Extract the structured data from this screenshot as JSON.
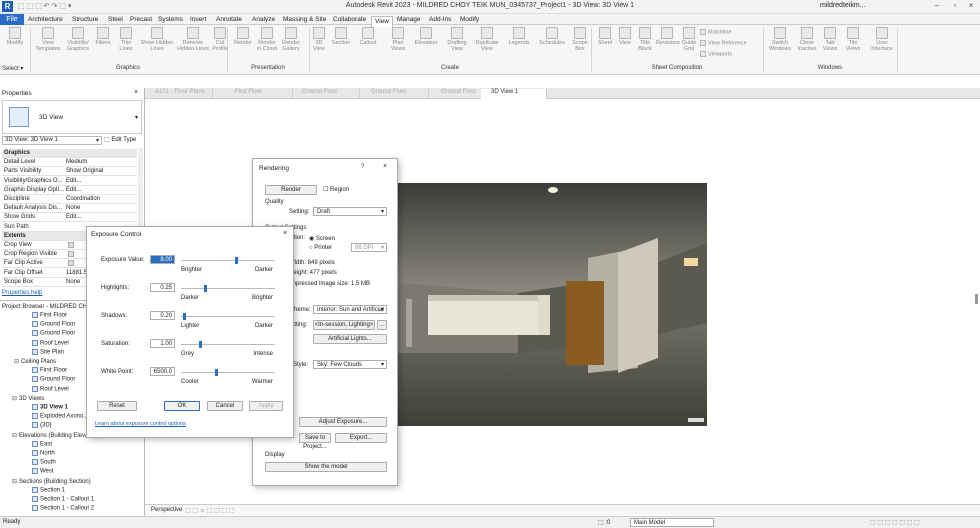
{
  "window": {
    "title": "Autodesk Revit 2023 - MILDRED CHOY TEIK MUN_0345737_Project1 - 3D View: 3D View 1",
    "user": "mildredteikm..."
  },
  "ribbon_tabs": [
    "Architecture",
    "Structure",
    "Steel",
    "Precast",
    "Systems",
    "Insert",
    "Annotate",
    "Analyze",
    "Massing & Site",
    "Collaborate",
    "View",
    "Manage",
    "Add-Ins",
    "Modify"
  ],
  "file_tab": "File",
  "ribbon": {
    "modify": "Modify",
    "select": "Select",
    "buttons": [
      "View Templates",
      "Visibility/ Graphics",
      "Filters",
      "Thin Lines",
      "Show Hidden Lines",
      "Remove Hidden Lines",
      "Cut Profile",
      "Render",
      "Render in Cloud",
      "Render Gallery",
      "3D View",
      "Section",
      "Callout",
      "Plan Views",
      "Elevation",
      "Drafting View",
      "Duplicate View",
      "Legends",
      "Schedules",
      "Scope Box",
      "Sheet",
      "View",
      "Title Block",
      "Revisions",
      "Guide Grid",
      "Matchline",
      "View Reference",
      "Viewports",
      "Switch Windows",
      "Close Inactive",
      "Tab Views",
      "Tile Views",
      "User Interface"
    ],
    "panels": [
      "Graphics",
      "Presentation",
      "Create",
      "Sheet Composition",
      "Windows"
    ]
  },
  "doc_tabs": [
    "A101 - Floor Plans",
    "First Floor",
    "Ground Floor",
    "Ground Floor",
    "Ground Floor",
    "3D View 1"
  ],
  "properties": {
    "header": "Properties",
    "type": "3D View",
    "selector": "3D View: 3D View 1",
    "edit_type": "Edit Type",
    "rows": [
      {
        "k": "Graphics",
        "v": "",
        "section": true
      },
      {
        "k": "Detail Level",
        "v": "Medium"
      },
      {
        "k": "Parts Visibility",
        "v": "Show Original"
      },
      {
        "k": "Visibility/Graphics O...",
        "v": "Edit..."
      },
      {
        "k": "Graphic Display Opti...",
        "v": "Edit..."
      },
      {
        "k": "Discipline",
        "v": "Coordination"
      },
      {
        "k": "Default Analysis Dis...",
        "v": "None"
      },
      {
        "k": "Show Grids",
        "v": "Edit..."
      },
      {
        "k": "Sun Path",
        "v": ""
      },
      {
        "k": "Extents",
        "v": "",
        "section": true
      },
      {
        "k": "Crop View",
        "v": ""
      },
      {
        "k": "Crop Region Visible",
        "v": ""
      },
      {
        "k": "Far Clip Active",
        "v": ""
      },
      {
        "k": "Far Clip Offset",
        "v": "11881.5"
      },
      {
        "k": "Scope Box",
        "v": "None"
      }
    ],
    "help": "Properties help"
  },
  "browser": {
    "title": "Project Browser - MILDRED CHO...",
    "items": [
      {
        "t": "First Floor",
        "l": 3
      },
      {
        "t": "Ground Floor",
        "l": 3
      },
      {
        "t": "Ground Floor",
        "l": 3
      },
      {
        "t": "Roof Level",
        "l": 3
      },
      {
        "t": "Site Plan",
        "l": 3
      },
      {
        "t": "Ceiling Plans",
        "l": 2
      },
      {
        "t": "First Floor",
        "l": 3
      },
      {
        "t": "Ground Floor",
        "l": 3
      },
      {
        "t": "Roof Level",
        "l": 3
      },
      {
        "t": "3D Views",
        "l": 1
      },
      {
        "t": "3D View 1",
        "l": 3
      },
      {
        "t": "Exploded Axono...",
        "l": 3
      },
      {
        "t": "{3D}",
        "l": 3
      },
      {
        "t": "Elevations (Building Elevation)",
        "l": 1
      },
      {
        "t": "East",
        "l": 3
      },
      {
        "t": "North",
        "l": 3
      },
      {
        "t": "South",
        "l": 3
      },
      {
        "t": "West",
        "l": 3
      },
      {
        "t": "Sections (Building Section)",
        "l": 1
      },
      {
        "t": "Section 1",
        "l": 3
      },
      {
        "t": "Section 1 - Callout 1",
        "l": 3
      },
      {
        "t": "Section 1 - Callout 2",
        "l": 3
      }
    ]
  },
  "rendering": {
    "title": "Rendering",
    "render_btn": "Render",
    "region": "Region",
    "quality_label": "Quality",
    "setting_label": "Setting:",
    "setting_value": "Draft",
    "output_label": "Output Settings",
    "resolution_label": "Resolution:",
    "screen": "Screen",
    "printer": "Printer",
    "dpi": "96 DPI",
    "width": "Width:  849 pixels",
    "height": "Height:  477 pixels",
    "image_size": "Uncompressed image size:  1.5 MB",
    "scheme_label": "Scheme:",
    "scheme_value": "Interior: Sun and Artificial",
    "sun_label": "Setting:",
    "sun_value": "<In-session, Lighting>",
    "artificial_lights": "Artificial Lights...",
    "style_label": "Style:",
    "style_value": "Sky: Few Clouds",
    "adjust_exposure": "Adjust Exposure...",
    "save_to_project": "Save to Project...",
    "export": "Export...",
    "display_label": "Display",
    "show_model": "Show the model"
  },
  "exposure": {
    "title": "Exposure Control",
    "rows": [
      {
        "label": "Exposure Value:",
        "value": "8.00",
        "left": "Brighter",
        "right": "Darker",
        "pos": 0.6
      },
      {
        "label": "Highlights:",
        "value": "0.25",
        "left": "Darker",
        "right": "Brighter",
        "pos": 0.25
      },
      {
        "label": "Shadows:",
        "value": "0.20",
        "left": "Lighter",
        "right": "Darker",
        "pos": 0.02
      },
      {
        "label": "Saturation:",
        "value": "1.00",
        "left": "Grey",
        "right": "Intense",
        "pos": 0.2
      },
      {
        "label": "White Point:",
        "value": "6500.0",
        "left": "Cooler",
        "right": "Warmer",
        "pos": 0.38
      }
    ],
    "reset": "Reset",
    "ok": "OK",
    "cancel": "Cancel",
    "apply": "Apply",
    "link": "Learn about exposure control options"
  },
  "viewbar": {
    "perspective": "Perspective"
  },
  "status": {
    "left": "Ready",
    "model": "Main Model",
    "zero": ":0"
  }
}
